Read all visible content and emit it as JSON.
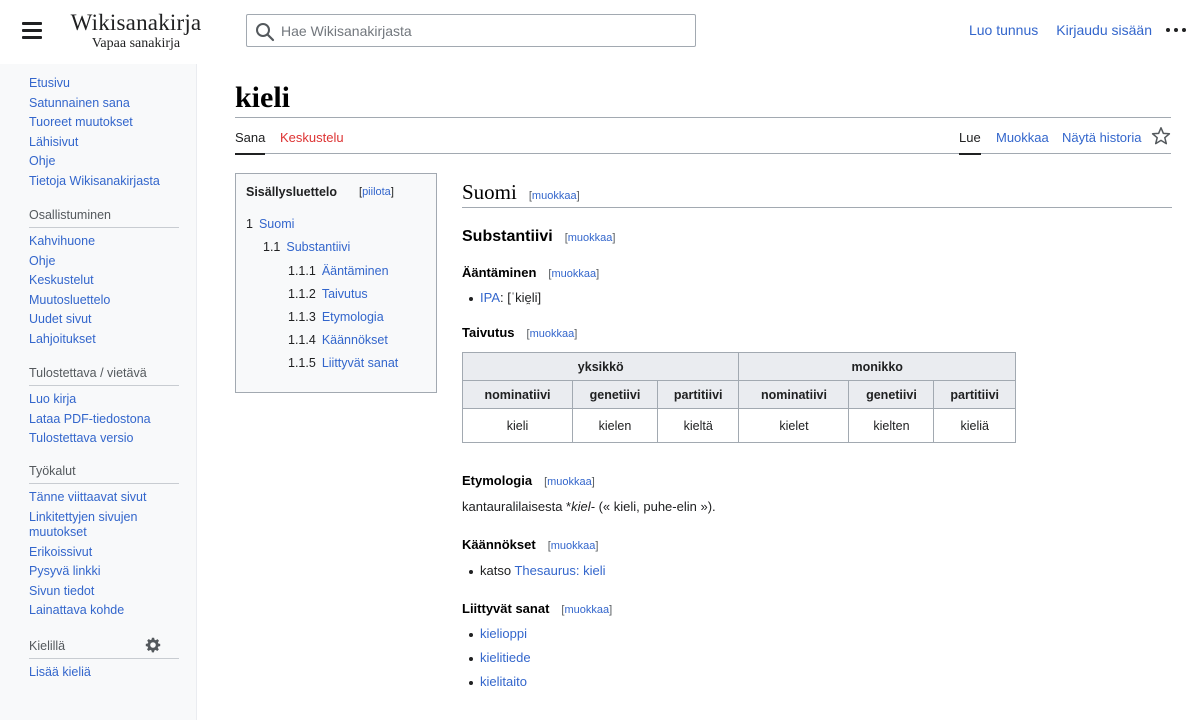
{
  "header": {
    "logo_wordmark": "Wikisanakirja",
    "logo_tagline": "Vapaa sanakirja",
    "search_placeholder": "Hae Wikisanakirjasta",
    "create_account": "Luo tunnus",
    "login": "Kirjaudu sisään"
  },
  "sidebar": {
    "main": [
      "Etusivu",
      "Satunnainen sana",
      "Tuoreet muutokset",
      "Lähisivut",
      "Ohje",
      "Tietoja Wikisanakirjasta"
    ],
    "participate": {
      "heading": "Osallistuminen",
      "items": [
        "Kahvihuone",
        "Ohje",
        "Keskustelut",
        "Muutosluettelo",
        "Uudet sivut",
        "Lahjoitukset"
      ]
    },
    "print": {
      "heading": "Tulostettava / vietävä",
      "items": [
        "Luo kirja",
        "Lataa PDF-tiedostona",
        "Tulostettava versio"
      ]
    },
    "tools": {
      "heading": "Työkalut",
      "items": [
        "Tänne viittaavat sivut",
        "Linkitettyjen sivujen muutokset",
        "Erikoissivut",
        "Pysyvä linkki",
        "Sivun tiedot",
        "Lainattava kohde"
      ]
    },
    "languages": {
      "heading": "Kielillä",
      "add": "Lisää kieliä"
    }
  },
  "page": {
    "title": "kieli",
    "tabs": {
      "word": "Sana",
      "talk": "Keskustelu",
      "read": "Lue",
      "edit": "Muokkaa",
      "history": "Näytä historia"
    }
  },
  "toc": {
    "title": "Sisällysluettelo",
    "toggle_open": "[",
    "toggle": "piilota",
    "toggle_close": "]",
    "items": [
      {
        "num": "1",
        "label": "Suomi"
      },
      {
        "num": "1.1",
        "label": "Substantiivi"
      },
      {
        "num": "1.1.1",
        "label": "Ääntäminen"
      },
      {
        "num": "1.1.2",
        "label": "Taivutus"
      },
      {
        "num": "1.1.3",
        "label": "Etymologia"
      },
      {
        "num": "1.1.4",
        "label": "Käännökset"
      },
      {
        "num": "1.1.5",
        "label": "Liittyvät sanat"
      }
    ]
  },
  "article": {
    "edit_open": "[",
    "edit_label": "muokkaa",
    "edit_close": "]",
    "lang_heading": "Suomi",
    "pos_heading": "Substantiivi",
    "pron_heading": "Ääntäminen",
    "pron_ipa_link": "IPA",
    "pron_ipa_value": ": [ˈkie̯li]",
    "infl_heading": "Taivutus",
    "infl_table": {
      "groups": [
        "yksikkö",
        "monikko"
      ],
      "cases": [
        "nominatiivi",
        "genetiivi",
        "partitiivi",
        "nominatiivi",
        "genetiivi",
        "partitiivi"
      ],
      "forms": [
        "kieli",
        "kielen",
        "kieltä",
        "kielet",
        "kielten",
        "kieliä"
      ]
    },
    "etym_heading": "Etymologia",
    "etym_prefix": "kantauralilaisesta *",
    "etym_italic": "kiel-",
    "etym_suffix": " (« kieli, puhe-elin »).",
    "trans_heading": "Käännökset",
    "trans_prefix": "katso ",
    "trans_link": "Thesaurus: kieli",
    "related_heading": "Liittyvät sanat",
    "related": [
      "kielioppi",
      "kielitiede",
      "kielitaito"
    ]
  }
}
